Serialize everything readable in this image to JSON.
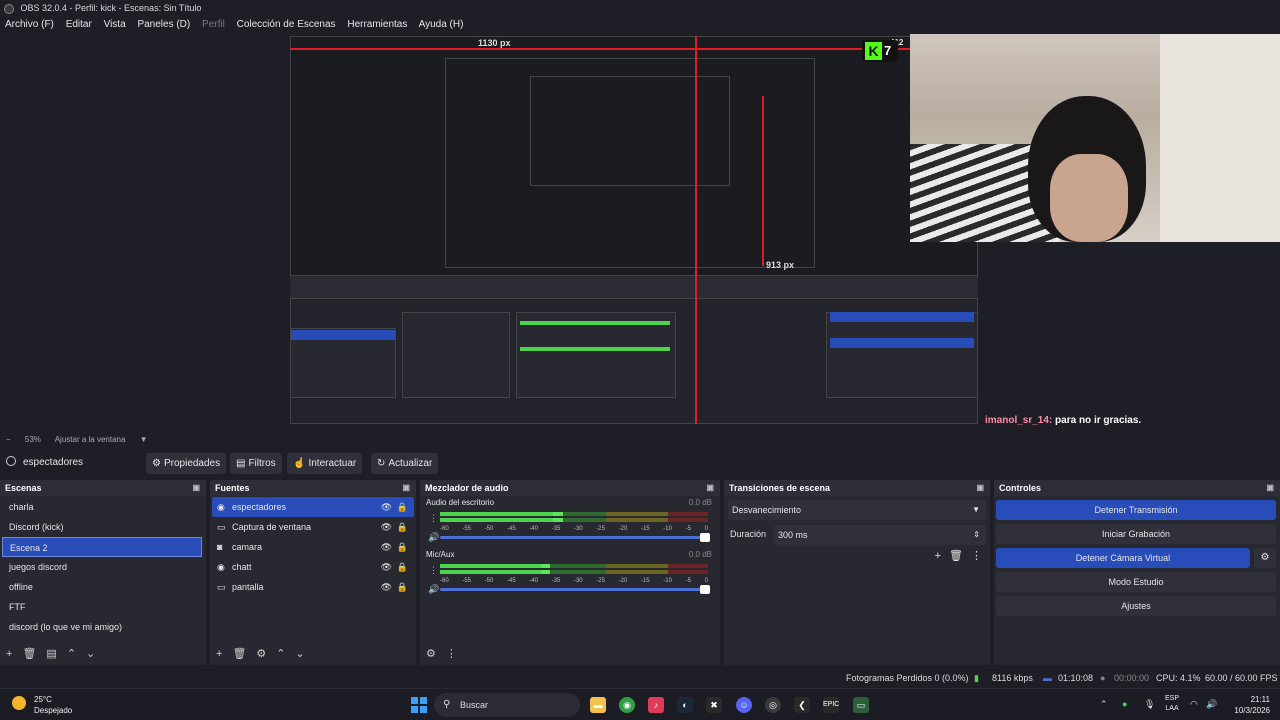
{
  "titlebar": {
    "title": "OBS 32.0.4 - Perfil: kick - Escenas: Sin Título"
  },
  "menu": {
    "items": [
      "Archivo (F)",
      "Editar",
      "Vista",
      "Paneles (D)",
      "Perfil",
      "Colección de Escenas",
      "Herramientas",
      "Ayuda (H)"
    ],
    "disabled_index": 4
  },
  "preview": {
    "nested_label_width": "1130 px",
    "nested_label_height": "913 px",
    "nested_label_right": "412",
    "overlay_badge_number": "7"
  },
  "chat": {
    "user": "imanol_sr_14:",
    "message": " para no ir gracias."
  },
  "zoom": {
    "value": "53%",
    "fit_label": "Ajustar a la ventana"
  },
  "toolbar": {
    "current_scene": "espectadores",
    "properties": "Propiedades",
    "filters": "Filtros",
    "interact": "Interactuar",
    "refresh": "Actualizar"
  },
  "scenes": {
    "title": "Escenas",
    "items": [
      "charla",
      "Discord (kick)",
      "Escena 2",
      "juegos discord",
      "offline",
      "FTF",
      "discord (lo que ve mi amigo)"
    ],
    "active_index": 2
  },
  "sources": {
    "title": "Fuentes",
    "items": [
      {
        "name": "espectadores",
        "icon": "globe-icon",
        "glyph": "◉"
      },
      {
        "name": "Captura de ventana",
        "icon": "window-icon",
        "glyph": "▭"
      },
      {
        "name": "camara",
        "icon": "camera-icon",
        "glyph": "◙"
      },
      {
        "name": "chatt",
        "icon": "globe-icon",
        "glyph": "◉"
      },
      {
        "name": "pantalla",
        "icon": "monitor-icon",
        "glyph": "▭"
      }
    ],
    "active_index": 0
  },
  "mixer": {
    "title": "Mezclador de audio",
    "channels": [
      {
        "name": "Audio del escritorio",
        "db": "0.0 dB",
        "level": 0.46
      },
      {
        "name": "Mic/Aux",
        "db": "0.0 dB",
        "level": 0.41
      }
    ],
    "scale": [
      "-60",
      "-55",
      "-50",
      "-45",
      "-40",
      "-35",
      "-30",
      "-25",
      "-20",
      "-15",
      "-10",
      "-5",
      "0"
    ]
  },
  "transitions": {
    "title": "Transiciones de escena",
    "selected": "Desvanecimiento",
    "duration_label": "Duración",
    "duration_value": "300 ms"
  },
  "controls": {
    "title": "Controles",
    "buttons": [
      "Detener Transmisión",
      "Iniciar Grabación",
      "Detener Cámara Virtual",
      "Modo Estudio",
      "Ajustes"
    ]
  },
  "status": {
    "dropped_frames": "Fotogramas Perdidos 0 (0.0%)",
    "bitrate": "8116 kbps",
    "stream_time": "01:10:08",
    "rec_time": "00:00:00",
    "cpu": "CPU: 4.1%",
    "fps": "60.00 / 60.00 FPS"
  },
  "taskbar": {
    "temp": "25°C",
    "weather": "Despejado",
    "search": "Buscar",
    "lang1": "ESP",
    "lang2": "LAA",
    "time": "21:11",
    "date": "10/3/2026"
  },
  "colors": {
    "accent": "#284cb8",
    "red_guide": "#e01c24",
    "kick_green": "#53fc18"
  }
}
